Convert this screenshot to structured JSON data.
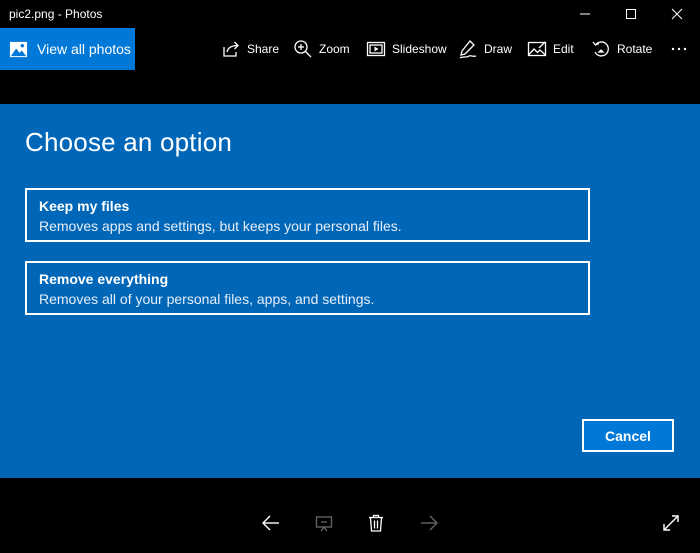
{
  "window": {
    "title": "pic2.png - Photos"
  },
  "toolbar": {
    "view_all_label": "View all photos",
    "items": [
      {
        "label": "Share",
        "icon": "share-icon"
      },
      {
        "label": "Zoom",
        "icon": "zoom-icon"
      },
      {
        "label": "Slideshow",
        "icon": "slideshow-icon"
      },
      {
        "label": "Draw",
        "icon": "draw-icon"
      },
      {
        "label": "Edit",
        "icon": "edit-icon"
      },
      {
        "label": "Rotate",
        "icon": "rotate-icon"
      }
    ],
    "more_label": "···"
  },
  "dialog": {
    "heading": "Choose an option",
    "options": [
      {
        "title": "Keep my files",
        "description": "Removes apps and settings, but keeps your personal files."
      },
      {
        "title": "Remove everything",
        "description": "Removes all of your personal files, apps, and settings."
      }
    ],
    "cancel_label": "Cancel"
  },
  "colors": {
    "accent": "#0078d7",
    "stage_background": "#0067b8",
    "chrome": "#000000",
    "text": "#ffffff"
  },
  "bottom_bar": {
    "icons": [
      "back-arrow-icon",
      "slideshow-add-icon",
      "delete-icon",
      "forward-arrow-icon",
      "fullscreen-icon"
    ]
  }
}
